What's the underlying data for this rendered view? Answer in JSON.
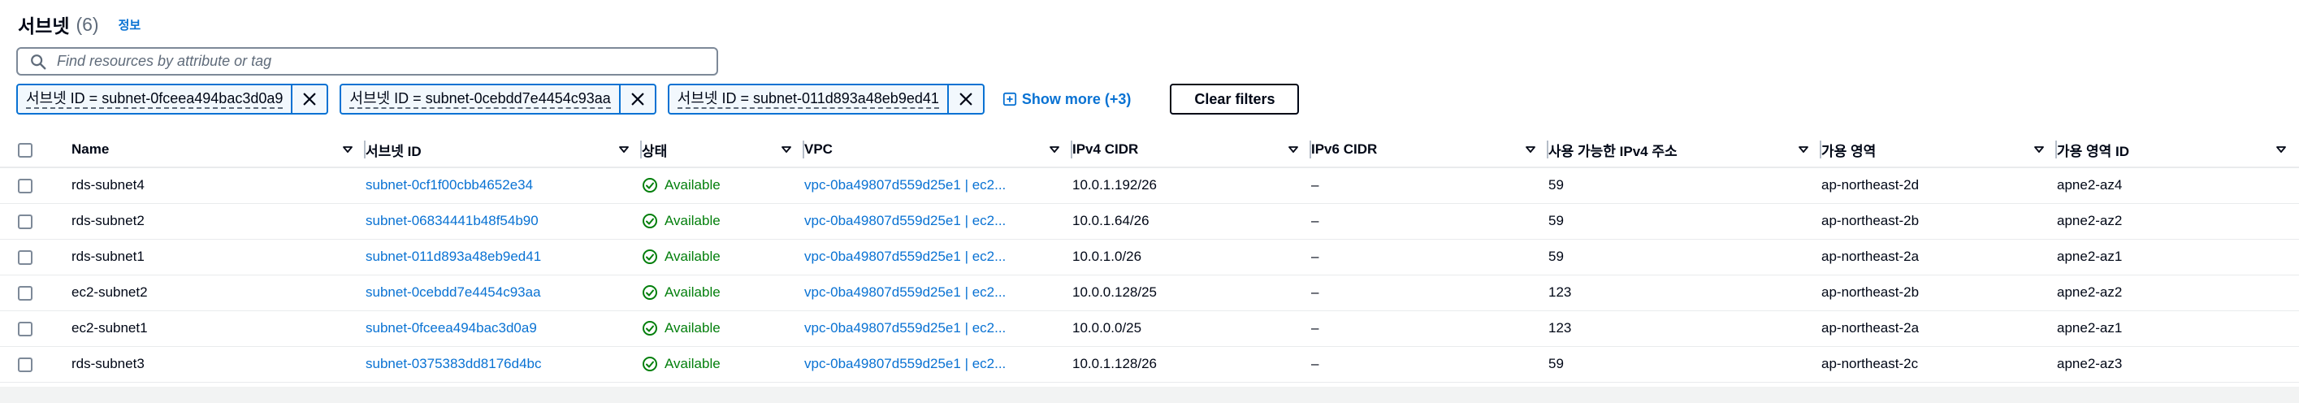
{
  "header": {
    "title": "서브넷",
    "count": "(6)",
    "info": "정보"
  },
  "search": {
    "placeholder": "Find resources by attribute or tag"
  },
  "filters": {
    "tokens": [
      {
        "label": "서브넷 ID = subnet-0fceea494bac3d0a9"
      },
      {
        "label": "서브넷 ID = subnet-0cebdd7e4454c93aa"
      },
      {
        "label": "서브넷 ID = subnet-011d893a48eb9ed41"
      }
    ],
    "show_more": "Show more (+3)",
    "clear": "Clear filters"
  },
  "table": {
    "columns": [
      "Name",
      "서브넷 ID",
      "상태",
      "VPC",
      "IPv4 CIDR",
      "IPv6 CIDR",
      "사용 가능한 IPv4 주소",
      "가용 영역",
      "가용 영역 ID"
    ],
    "rows": [
      {
        "name": "rds-subnet4",
        "subnet_id": "subnet-0cf1f00cbb4652e34",
        "status": "Available",
        "vpc": "vpc-0ba49807d559d25e1 | ec2...",
        "ipv4": "10.0.1.192/26",
        "ipv6": "–",
        "avail": "59",
        "az": "ap-northeast-2d",
        "azid": "apne2-az4"
      },
      {
        "name": "rds-subnet2",
        "subnet_id": "subnet-06834441b48f54b90",
        "status": "Available",
        "vpc": "vpc-0ba49807d559d25e1 | ec2...",
        "ipv4": "10.0.1.64/26",
        "ipv6": "–",
        "avail": "59",
        "az": "ap-northeast-2b",
        "azid": "apne2-az2"
      },
      {
        "name": "rds-subnet1",
        "subnet_id": "subnet-011d893a48eb9ed41",
        "status": "Available",
        "vpc": "vpc-0ba49807d559d25e1 | ec2...",
        "ipv4": "10.0.1.0/26",
        "ipv6": "–",
        "avail": "59",
        "az": "ap-northeast-2a",
        "azid": "apne2-az1"
      },
      {
        "name": "ec2-subnet2",
        "subnet_id": "subnet-0cebdd7e4454c93aa",
        "status": "Available",
        "vpc": "vpc-0ba49807d559d25e1 | ec2...",
        "ipv4": "10.0.0.128/25",
        "ipv6": "–",
        "avail": "123",
        "az": "ap-northeast-2b",
        "azid": "apne2-az2"
      },
      {
        "name": "ec2-subnet1",
        "subnet_id": "subnet-0fceea494bac3d0a9",
        "status": "Available",
        "vpc": "vpc-0ba49807d559d25e1 | ec2...",
        "ipv4": "10.0.0.0/25",
        "ipv6": "–",
        "avail": "123",
        "az": "ap-northeast-2a",
        "azid": "apne2-az1"
      },
      {
        "name": "rds-subnet3",
        "subnet_id": "subnet-0375383dd8176d4bc",
        "status": "Available",
        "vpc": "vpc-0ba49807d559d25e1 | ec2...",
        "ipv4": "10.0.1.128/26",
        "ipv6": "–",
        "avail": "59",
        "az": "ap-northeast-2c",
        "azid": "apne2-az3"
      }
    ]
  },
  "colors": {
    "link": "#0972d3",
    "success": "#037f0c",
    "text": "#000716",
    "muted": "#5f6b7a"
  },
  "icons": {
    "search": "search-icon",
    "close": "close-icon",
    "expand": "plus-square-icon",
    "sort": "caret-down-icon",
    "status": "check-circle-icon"
  }
}
